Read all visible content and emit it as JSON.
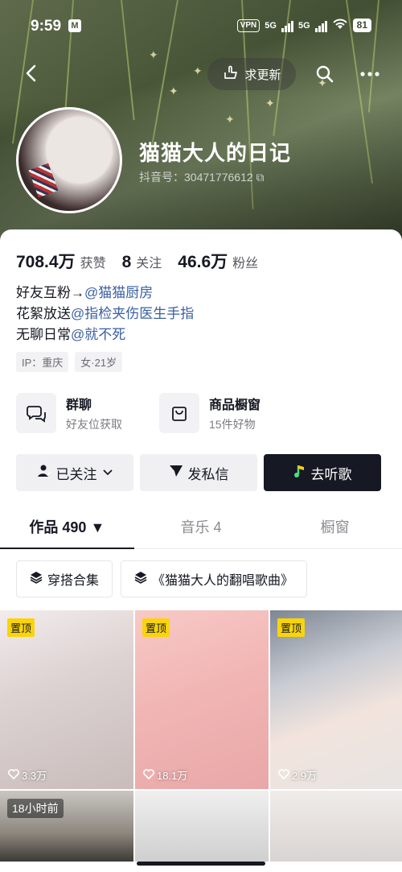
{
  "status": {
    "time": "9:59",
    "m_badge": "M",
    "vpn": "VPN",
    "net1": "5G",
    "net2": "5G",
    "battery": "81"
  },
  "topbar": {
    "update_label": "求更新"
  },
  "profile": {
    "name": "猫猫大人的日记",
    "douyin_id": "抖音号：30471776612"
  },
  "stats": [
    {
      "value": "708.4万",
      "label": "获赞"
    },
    {
      "value": "8",
      "label": "关注"
    },
    {
      "value": "46.6万",
      "label": "粉丝"
    }
  ],
  "bio": [
    {
      "prefix": "好友互粉→",
      "mention": "@猫猫厨房"
    },
    {
      "prefix": "花絮放送",
      "mention": "@指检夹伤医生手指"
    },
    {
      "prefix": "无聊日常",
      "mention": "@就不死"
    }
  ],
  "tags": [
    "IP：重庆",
    "女·21岁"
  ],
  "features": [
    {
      "title": "群聊",
      "sub": "好友位获取"
    },
    {
      "title": "商品橱窗",
      "sub": "15件好物"
    }
  ],
  "actions": {
    "followed": "已关注",
    "message": "发私信",
    "music": "去听歌"
  },
  "tabs": [
    {
      "label": "作品 490 ▼"
    },
    {
      "label": "音乐 4"
    },
    {
      "label": "橱窗"
    }
  ],
  "collections": [
    "穿搭合集",
    "《猫猫大人的翻唱歌曲》"
  ],
  "videos": [
    {
      "badge": "置顶",
      "likes": "3.3万"
    },
    {
      "badge": "置顶",
      "likes": "18.1万"
    },
    {
      "badge": "置顶",
      "likes": "2.9万"
    },
    {
      "time_badge": "18小时前"
    },
    {},
    {}
  ],
  "colors": {
    "pin_yellow": "#f9d40b",
    "mention_blue": "#3a5fa0",
    "dark_button": "#161823"
  }
}
